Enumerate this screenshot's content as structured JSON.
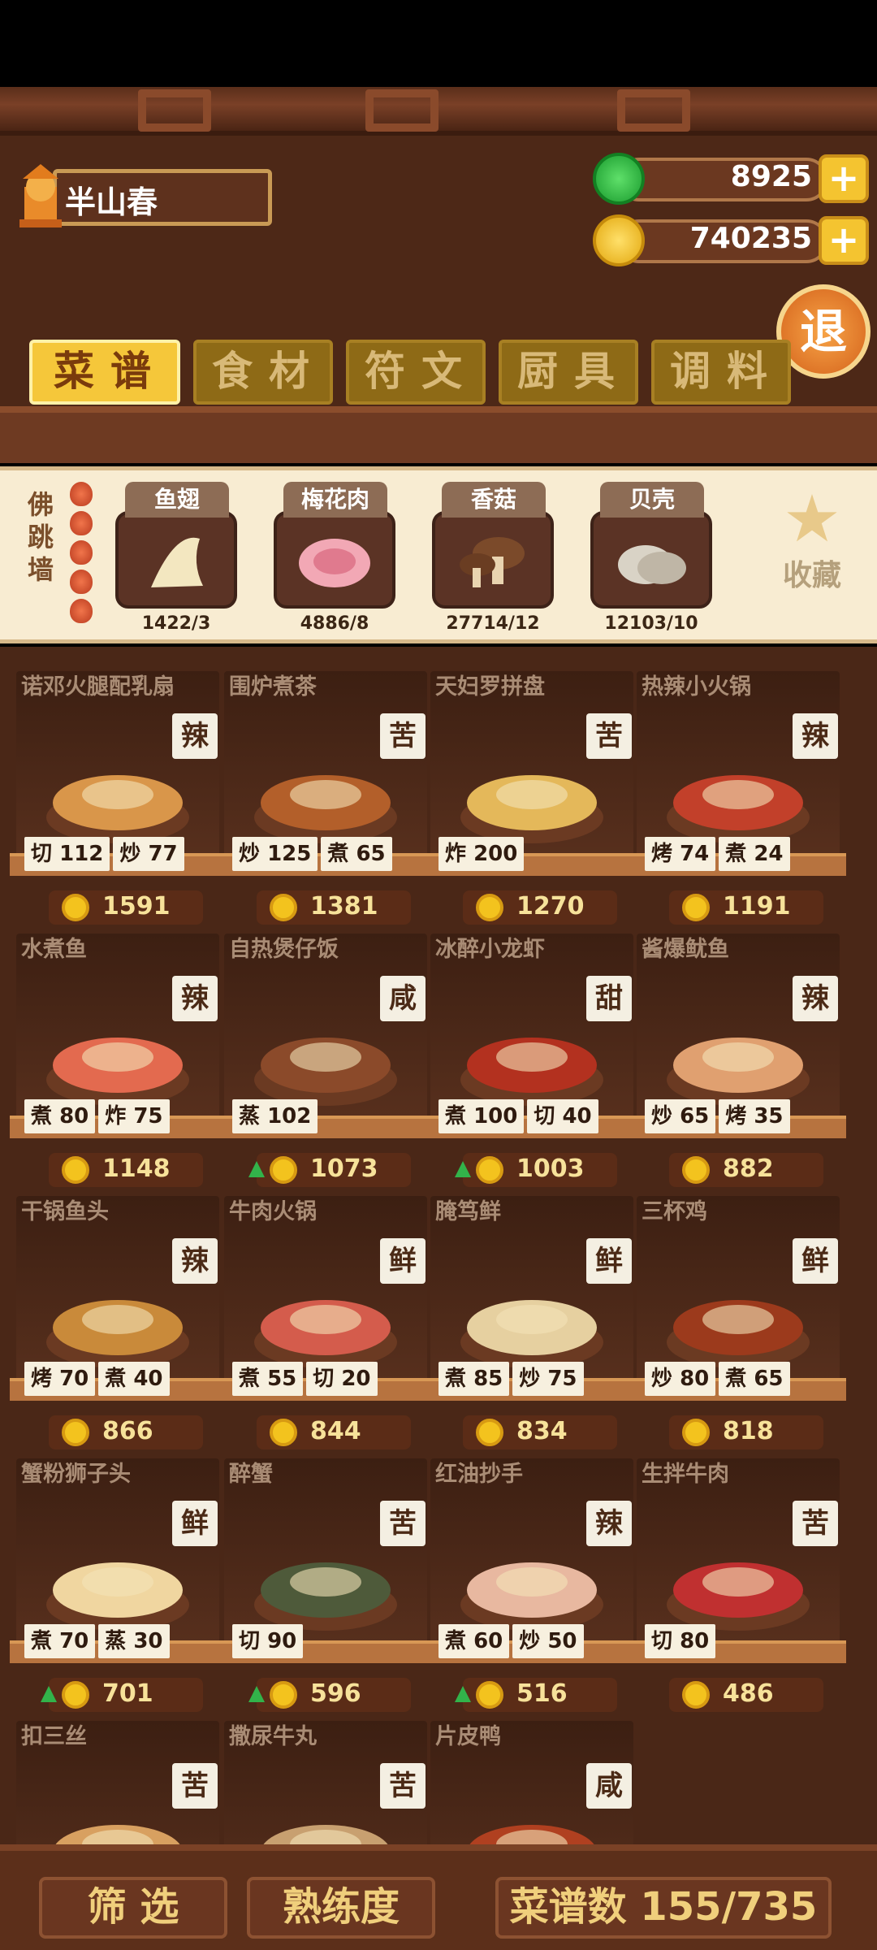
{
  "player": {
    "name": "半山春",
    "avatar_icon": "chef-avatar-icon"
  },
  "currency": {
    "jade": {
      "value": "8925",
      "icon": "jade-icon"
    },
    "coins": {
      "value": "740235",
      "icon": "coin-icon"
    },
    "plus_label": "+"
  },
  "exit_label": "退",
  "tabs": [
    {
      "label": "菜谱",
      "active": true
    },
    {
      "label": "食材",
      "active": false
    },
    {
      "label": "符文",
      "active": false
    },
    {
      "label": "厨具",
      "active": false
    },
    {
      "label": "调料",
      "active": false
    }
  ],
  "selected_recipe": {
    "name": "佛跳墙",
    "ingredients": [
      {
        "name": "鱼翅",
        "count": "1422/3",
        "icon": "shark-fin-icon"
      },
      {
        "name": "梅花肉",
        "count": "4886/8",
        "icon": "pork-icon"
      },
      {
        "name": "香菇",
        "count": "27714/12",
        "icon": "mushroom-icon"
      },
      {
        "name": "贝壳",
        "count": "12103/10",
        "icon": "shell-icon"
      }
    ],
    "collect_label": "收藏"
  },
  "recipes": [
    {
      "name": "诺邓火腿配乳扇",
      "flavor": "辣",
      "skills": [
        [
          "切",
          "112"
        ],
        [
          "炒",
          "77"
        ]
      ],
      "price": "1591",
      "up": false
    },
    {
      "name": "围炉煮茶",
      "flavor": "苦",
      "skills": [
        [
          "炒",
          "125"
        ],
        [
          "煮",
          "65"
        ]
      ],
      "price": "1381",
      "up": false
    },
    {
      "name": "天妇罗拼盘",
      "flavor": "苦",
      "skills": [
        [
          "炸",
          "200"
        ]
      ],
      "price": "1270",
      "up": false
    },
    {
      "name": "热辣小火锅",
      "flavor": "辣",
      "skills": [
        [
          "烤",
          "74"
        ],
        [
          "煮",
          "24"
        ]
      ],
      "price": "1191",
      "up": false
    },
    {
      "name": "水煮鱼",
      "flavor": "辣",
      "skills": [
        [
          "煮",
          "80"
        ],
        [
          "炸",
          "75"
        ]
      ],
      "price": "1148",
      "up": false
    },
    {
      "name": "自热煲仔饭",
      "flavor": "咸",
      "skills": [
        [
          "蒸",
          "102"
        ]
      ],
      "price": "1073",
      "up": true
    },
    {
      "name": "冰醉小龙虾",
      "flavor": "甜",
      "skills": [
        [
          "煮",
          "100"
        ],
        [
          "切",
          "40"
        ]
      ],
      "price": "1003",
      "up": true
    },
    {
      "name": "酱爆鱿鱼",
      "flavor": "辣",
      "skills": [
        [
          "炒",
          "65"
        ],
        [
          "烤",
          "35"
        ]
      ],
      "price": "882",
      "up": false
    },
    {
      "name": "干锅鱼头",
      "flavor": "辣",
      "skills": [
        [
          "烤",
          "70"
        ],
        [
          "煮",
          "40"
        ]
      ],
      "price": "866",
      "up": false
    },
    {
      "name": "牛肉火锅",
      "flavor": "鲜",
      "skills": [
        [
          "煮",
          "55"
        ],
        [
          "切",
          "20"
        ]
      ],
      "price": "844",
      "up": false
    },
    {
      "name": "腌笃鲜",
      "flavor": "鲜",
      "skills": [
        [
          "煮",
          "85"
        ],
        [
          "炒",
          "75"
        ]
      ],
      "price": "834",
      "up": false
    },
    {
      "name": "三杯鸡",
      "flavor": "鲜",
      "skills": [
        [
          "炒",
          "80"
        ],
        [
          "煮",
          "65"
        ]
      ],
      "price": "818",
      "up": false
    },
    {
      "name": "蟹粉狮子头",
      "flavor": "鲜",
      "skills": [
        [
          "煮",
          "70"
        ],
        [
          "蒸",
          "30"
        ]
      ],
      "price": "701",
      "up": true
    },
    {
      "name": "醉蟹",
      "flavor": "苦",
      "skills": [
        [
          "切",
          "90"
        ]
      ],
      "price": "596",
      "up": true
    },
    {
      "name": "红油抄手",
      "flavor": "辣",
      "skills": [
        [
          "煮",
          "60"
        ],
        [
          "炒",
          "50"
        ]
      ],
      "price": "516",
      "up": true
    },
    {
      "name": "生拌牛肉",
      "flavor": "苦",
      "skills": [
        [
          "切",
          "80"
        ]
      ],
      "price": "486",
      "up": false
    },
    {
      "name": "扣三丝",
      "flavor": "苦",
      "skills": [],
      "price": "",
      "up": false
    },
    {
      "name": "撒尿牛丸",
      "flavor": "苦",
      "skills": [],
      "price": "",
      "up": false
    },
    {
      "name": "片皮鸭",
      "flavor": "咸",
      "skills": [],
      "price": "",
      "up": false
    }
  ],
  "bottom": {
    "filter_label": "筛 选",
    "proficiency_label": "熟练度",
    "recipe_count_label": "菜谱数 155/735"
  },
  "colors": {
    "tab_active": "#f5c73a",
    "tab_inactive": "#8e6a16",
    "wood": "#4a2717",
    "coin": "#f3c31e"
  }
}
